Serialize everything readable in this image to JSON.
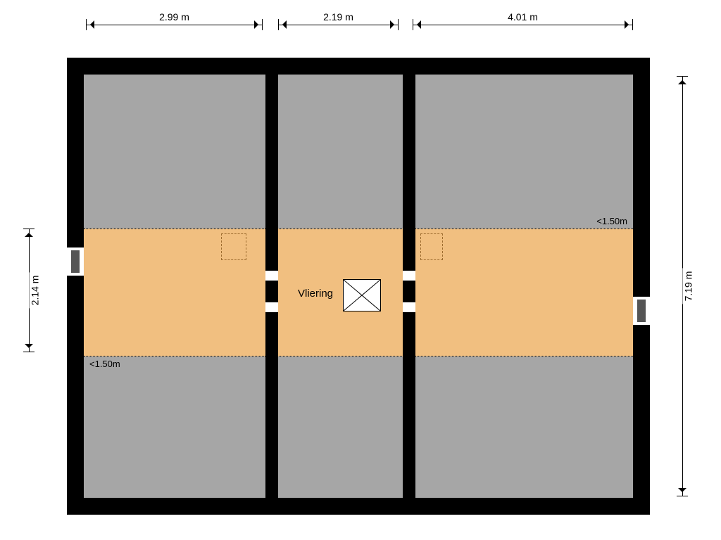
{
  "dims": {
    "top": {
      "seg1": "2.99 m",
      "seg2": "2.19 m",
      "seg3": "4.01 m"
    },
    "left": "2.14 m",
    "right": "7.19 m"
  },
  "ceiling": {
    "upper": "<1.50m",
    "lower": "<1.50m"
  },
  "rooms": {
    "center": "Vliering"
  }
}
